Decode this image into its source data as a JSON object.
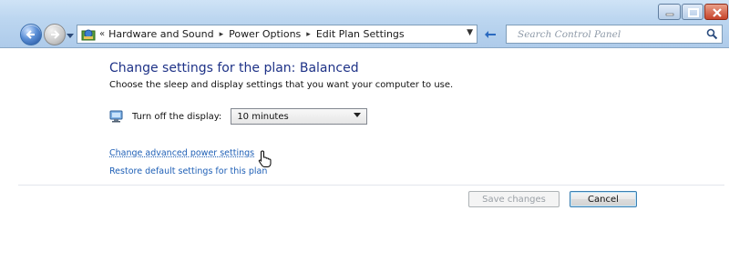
{
  "window": {
    "controls": {
      "minimize": "minimize-icon",
      "maximize": "maximize-icon",
      "close": "close-icon"
    }
  },
  "address_bar": {
    "overflow": "«",
    "breadcrumbs": [
      "Hardware and Sound",
      "Power Options",
      "Edit Plan Settings"
    ],
    "separator": "▸",
    "icons": {
      "back": "back-arrow-icon",
      "forward": "forward-arrow-icon",
      "location": "control-panel-icon",
      "refresh": "refresh-icon"
    }
  },
  "search": {
    "placeholder": "Search Control Panel",
    "icon": "search-icon"
  },
  "main": {
    "title": "Change settings for the plan: Balanced",
    "subtitle": "Choose the sleep and display settings that you want your computer to use.",
    "display_label": "Turn off the display:",
    "display_value": "10 minutes",
    "advanced_link": "Change advanced power settings",
    "restore_link": "Restore default settings for this plan"
  },
  "buttons": {
    "save": "Save changes",
    "cancel": "Cancel"
  },
  "colors": {
    "heading": "#1e3287",
    "link": "#1e5fb6",
    "chrome": "#bcd6f0"
  }
}
